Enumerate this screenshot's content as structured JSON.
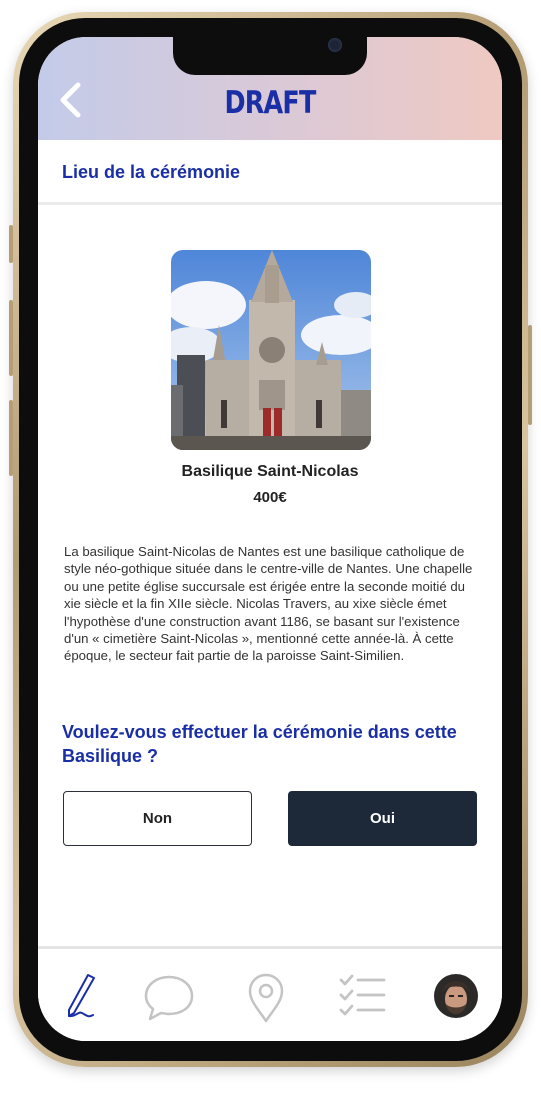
{
  "header": {
    "title": "DRAFT",
    "back_icon": "chevron-left-icon"
  },
  "section": {
    "title": "Lieu de la cérémonie"
  },
  "venue": {
    "name": "Basilique Saint-Nicolas",
    "price": "400€",
    "description": "La basilique Saint-Nicolas de Nantes est une basilique catholique de style néo-gothique située dans le centre-ville de Nantes. Une chapelle ou une petite église succursale est érigée entre la seconde moitié du xie siècle et la fin XIIe siècle. Nicolas Travers, au xixe siècle émet l'hypothèse d'une construction avant 1186, se basant sur l'existence d'un « cimetière Saint-Nicolas », mentionné cette année-là. À cette époque, le secteur fait partie de la paroisse Saint-Similien."
  },
  "question": "Voulez-vous effectuer la cérémonie dans cette Basilique ?",
  "buttons": {
    "no": "Non",
    "yes": "Oui"
  },
  "tabbar": {
    "items": [
      {
        "icon": "pen-icon",
        "active": true
      },
      {
        "icon": "chat-bubble-icon",
        "active": false
      },
      {
        "icon": "map-pin-icon",
        "active": false
      },
      {
        "icon": "checklist-icon",
        "active": false
      },
      {
        "icon": "avatar",
        "active": false
      }
    ]
  },
  "colors": {
    "accent": "#1a2fa6",
    "dark_button": "#1d2838",
    "inactive_icon": "#c4c4c4"
  }
}
